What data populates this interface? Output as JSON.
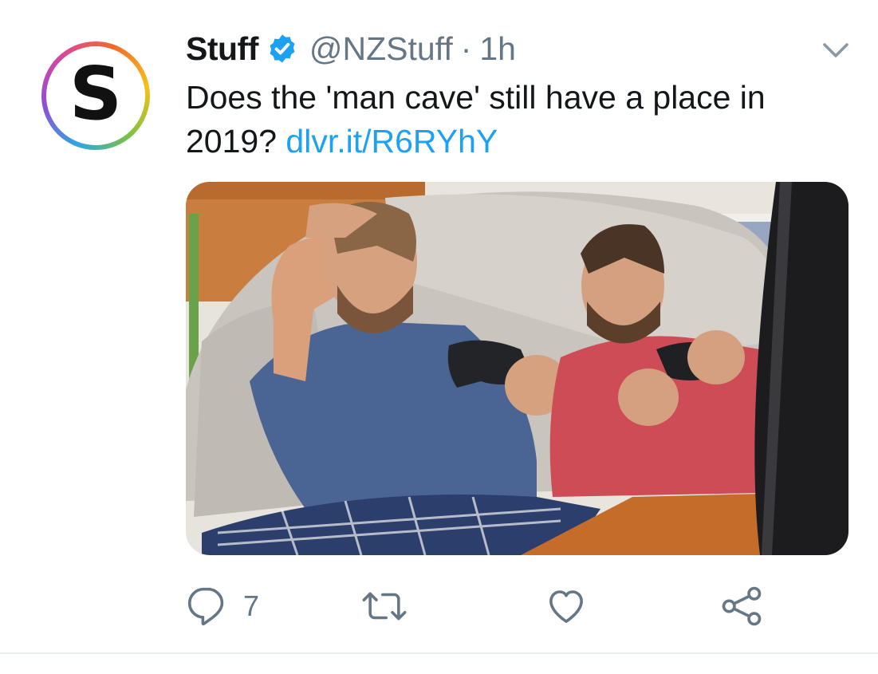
{
  "tweet": {
    "author": {
      "display_name": "Stuff",
      "handle": "@NZStuff",
      "verified": true,
      "avatar_letter": "S"
    },
    "separator": "·",
    "timestamp": "1h",
    "text": "Does the 'man cave' still have a place in 2019?",
    "link": "dlvr.it/R6RYhY",
    "media": {
      "icon": "photo-two-men-gaming"
    },
    "actions": {
      "reply_count": "7",
      "reply_icon": "reply-icon",
      "retweet_icon": "retweet-icon",
      "like_icon": "heart-icon",
      "share_icon": "share-icon"
    }
  },
  "colors": {
    "text_primary": "#14171a",
    "text_secondary": "#657786",
    "link": "#1da1f2",
    "verified_badge": "#1da1f2",
    "divider": "#e6ecf0"
  }
}
